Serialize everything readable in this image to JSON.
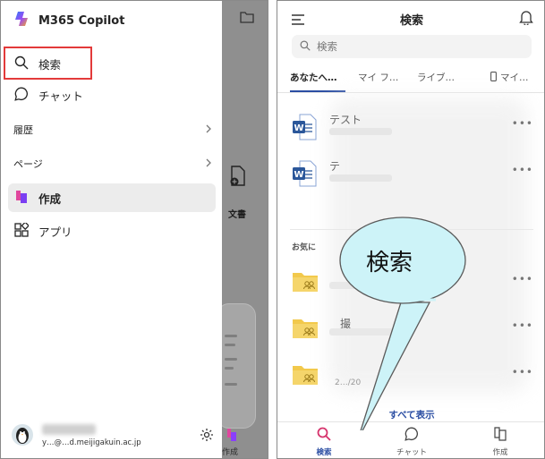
{
  "left": {
    "brand": "M365 Copilot",
    "nav": {
      "search": "検索",
      "chat": "チャット",
      "history": "履歴",
      "pages": "ページ",
      "create": "作成",
      "apps": "アプリ"
    },
    "behind": {
      "doc_label": "文書",
      "create_label": "作成"
    },
    "user": {
      "email": "y…@…d.meijigakuin.ac.jp"
    }
  },
  "right": {
    "title": "検索",
    "search_placeholder": "検索",
    "tabs": [
      "あなたへ…",
      "マイ フ…",
      "ライブ…",
      "マイ…"
    ],
    "files": [
      {
        "name": "テスト"
      },
      {
        "name": "テ"
      }
    ],
    "favorites_header": "お気に",
    "folders": [
      {
        "name": ""
      },
      {
        "name": "撮"
      },
      {
        "name": "2…/20"
      }
    ],
    "show_all": "すべて表示",
    "bottom_nav": {
      "search": "検索",
      "chat": "チャット",
      "create": "作成"
    },
    "callout": "検索"
  },
  "colors": {
    "accent": "#2b4ea3",
    "highlight_box": "#e33a3a",
    "word_blue": "#2b579a",
    "folder_yellow": "#f2c94c",
    "callout_fill": "#cdf3f8"
  }
}
